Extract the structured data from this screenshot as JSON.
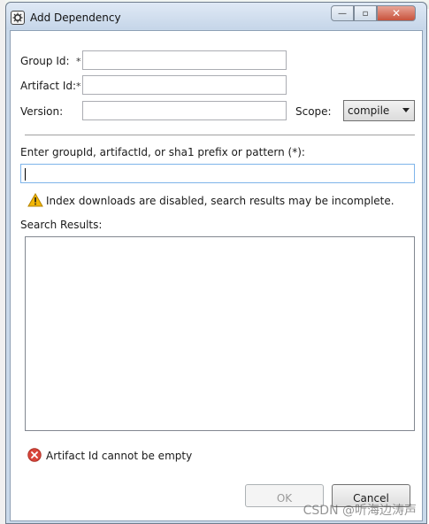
{
  "window": {
    "title": "Add Dependency",
    "buttons": {
      "minimize": "—",
      "maximize": "▫",
      "close": "✕"
    }
  },
  "form": {
    "group_id_label": "Group Id:",
    "artifact_id_label": "Artifact Id:",
    "version_label": "Version:",
    "required_marker": "*",
    "scope_label": "Scope:",
    "scope_value": "compile",
    "group_id_value": "",
    "artifact_id_value": "",
    "version_value": ""
  },
  "search": {
    "prompt": "Enter groupId, artifactId, or sha1 prefix or pattern (*):",
    "value": "",
    "warning": "Index downloads are disabled, search results may be incomplete.",
    "results_label": "Search Results:"
  },
  "status": {
    "error": "Artifact Id cannot be empty"
  },
  "actions": {
    "ok_label": "OK",
    "cancel_label": "Cancel"
  },
  "watermark": "CSDN @听海边涛声",
  "colors": {
    "warning": "#f2b705",
    "error": "#d8453a",
    "focus_border": "#7eb4ea"
  },
  "icons": {
    "app": "eclipse-dialog-icon",
    "warning": "warning-triangle-icon",
    "error": "error-circle-icon"
  }
}
